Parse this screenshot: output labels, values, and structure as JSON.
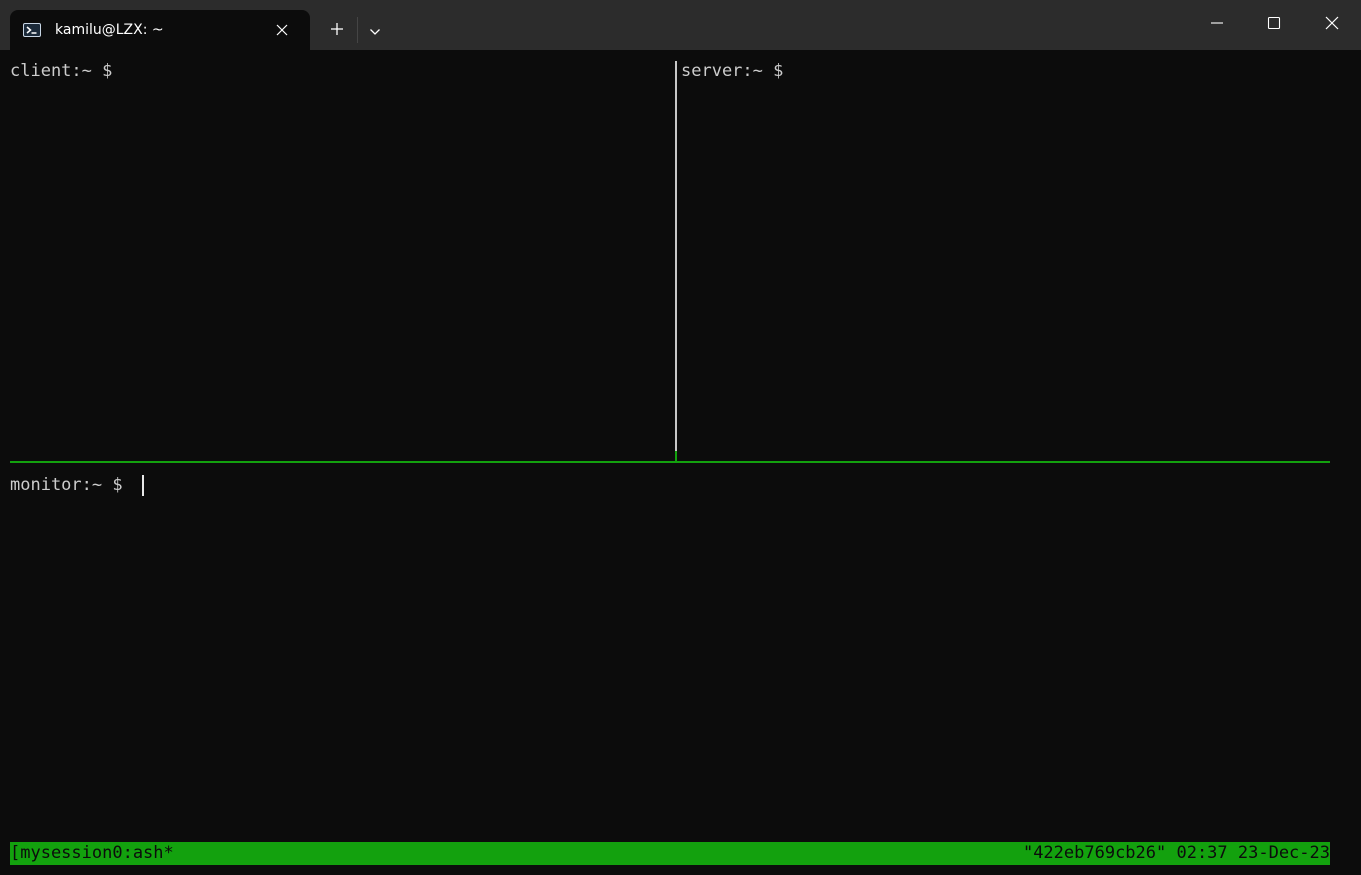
{
  "titlebar": {
    "tab_title": "kamilu@LZX: ~",
    "tab_icon": "powershell-icon",
    "close_tab_icon": "close-icon",
    "new_tab_icon": "plus-icon",
    "dropdown_icon": "chevron-down-icon",
    "window_controls": [
      "minimize-icon",
      "maximize-icon",
      "close-icon"
    ]
  },
  "panes": {
    "client": {
      "prompt": "client:~ $"
    },
    "server": {
      "prompt": "server:~ $"
    },
    "monitor": {
      "prompt": "monitor:~ $"
    }
  },
  "tmux": {
    "status_left": "[mysession0:ash*",
    "status_right": "\"422eb769cb26\" 02:37 23-Dec-23",
    "accent_color": "#13a10e"
  }
}
